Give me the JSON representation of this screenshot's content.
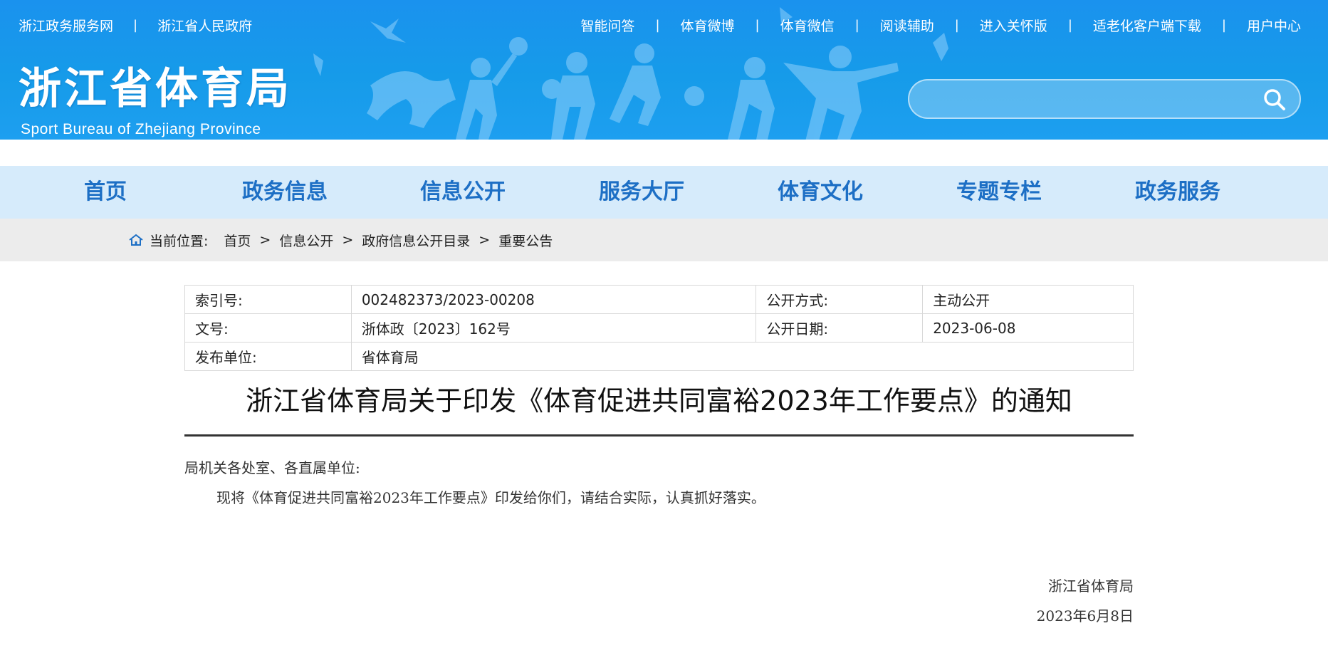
{
  "header": {
    "left_links": [
      "浙江政务服务网",
      "浙江省人民政府"
    ],
    "right_links": [
      "智能问答",
      "体育微博",
      "体育微信",
      "阅读辅助",
      "进入关怀版",
      "适老化客户端下载",
      "用户中心"
    ],
    "separator": "|",
    "logo_cn": "浙江省体育局",
    "logo_en": "Sport Bureau of Zhejiang Province",
    "search_placeholder": "",
    "search_icon": "search-icon"
  },
  "nav": {
    "items": [
      "首页",
      "政务信息",
      "信息公开",
      "服务大厅",
      "体育文化",
      "专题专栏",
      "政务服务"
    ]
  },
  "breadcrumb": {
    "label": "当前位置:",
    "items": [
      "首页",
      "信息公开",
      "政府信息公开目录",
      "重要公告"
    ],
    "separator": ">",
    "icon": "home-icon"
  },
  "meta": {
    "index_label": "索引号:",
    "index_value": "002482373/2023-00208",
    "mode_label": "公开方式:",
    "mode_value": "主动公开",
    "docno_label": "文号:",
    "docno_value": "浙体政〔2023〕162号",
    "date_label": "公开日期:",
    "date_value": "2023-06-08",
    "publisher_label": "发布单位:",
    "publisher_value": "省体育局"
  },
  "article": {
    "title": "浙江省体育局关于印发《体育促进共同富裕2023年工作要点》的通知",
    "salutation": "局机关各处室、各直属单位:",
    "paragraph": "现将《体育促进共同富裕2023年工作要点》印发给你们，请结合实际，认真抓好落实。",
    "signer": "浙江省体育局",
    "sign_date": "2023年6月8日"
  },
  "colors": {
    "banner": "#1a92ee",
    "nav_bg": "#d6ebfb",
    "nav_text": "#1d6fc5",
    "crumb_bg": "#ececec"
  }
}
